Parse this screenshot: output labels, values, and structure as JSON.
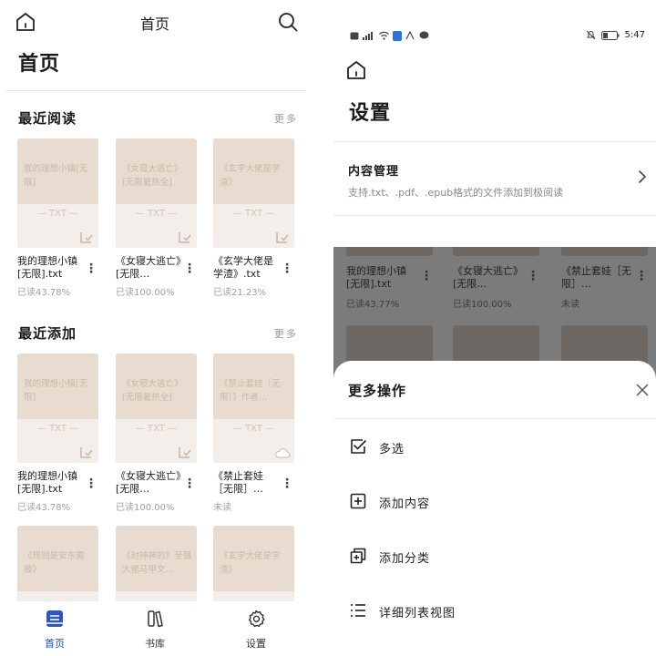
{
  "left": {
    "header": {
      "title": "首页"
    },
    "page_title": "首页",
    "recent_read": {
      "title": "最近阅读",
      "more": "更多",
      "books": [
        {
          "cover_text": "我的理想小镇[无限]",
          "format": "— TXT —",
          "name": "我的理想小镇[无限].txt",
          "progress": "已读43.78%",
          "icon": "downloaded-icon"
        },
        {
          "cover_text": "《女寝大逃亡》[无限暑热全]",
          "format": "— TXT —",
          "name": "《女寝大逃亡》[无限…",
          "progress": "已读100.00%",
          "icon": "downloaded-icon"
        },
        {
          "cover_text": "《玄学大佬是学渣》",
          "format": "— TXT —",
          "name": "《玄学大佬是学渣》.txt",
          "progress": "已读21.23%",
          "icon": "downloaded-icon"
        }
      ]
    },
    "recent_add": {
      "title": "最近添加",
      "more": "更多",
      "books": [
        {
          "cover_text": "我的理想小镇[无限]",
          "format": "— TXT —",
          "name": "我的理想小镇[无限].txt",
          "progress": "已读43.78%",
          "icon": "downloaded-icon"
        },
        {
          "cover_text": "《女寝大逃亡》[无限暑热全]",
          "format": "— TXT —",
          "name": "《女寝大逃亡》[无限…",
          "progress": "已读100.00%",
          "icon": "downloaded-icon"
        },
        {
          "cover_text": "《禁止套娃［无限］》作者…",
          "format": "— TXT —",
          "name": "《禁止套娃［无限］…",
          "progress": "未读",
          "icon": "cloud-icon"
        }
      ]
    },
    "third_row": [
      {
        "cover_text": "《规则是安东需被》"
      },
      {
        "cover_text": "《封神神的》至强大佬马甲文…"
      },
      {
        "cover_text": "《玄学大佬是学渣》"
      }
    ],
    "nav": [
      {
        "label": "首页"
      },
      {
        "label": "书库"
      },
      {
        "label": "设置"
      }
    ]
  },
  "right": {
    "status": {
      "time": "5:47"
    },
    "page_title": "设置",
    "content_manage": {
      "title": "内容管理",
      "desc": "支持.txt、.pdf、.epub格式的文件添加到极阅读"
    },
    "dimmed_books": [
      {
        "name": "我的理想小镇[无限].txt",
        "progress": "已读43.77%"
      },
      {
        "name": "《女寝大逃亡》[无限…",
        "progress": "已读100.00%"
      },
      {
        "name": "《禁止套娃［无限］…",
        "progress": "未读"
      }
    ],
    "sheet": {
      "title": "更多操作",
      "items": [
        {
          "label": "多选"
        },
        {
          "label": "添加内容"
        },
        {
          "label": "添加分类"
        },
        {
          "label": "详细列表视图"
        }
      ]
    }
  }
}
